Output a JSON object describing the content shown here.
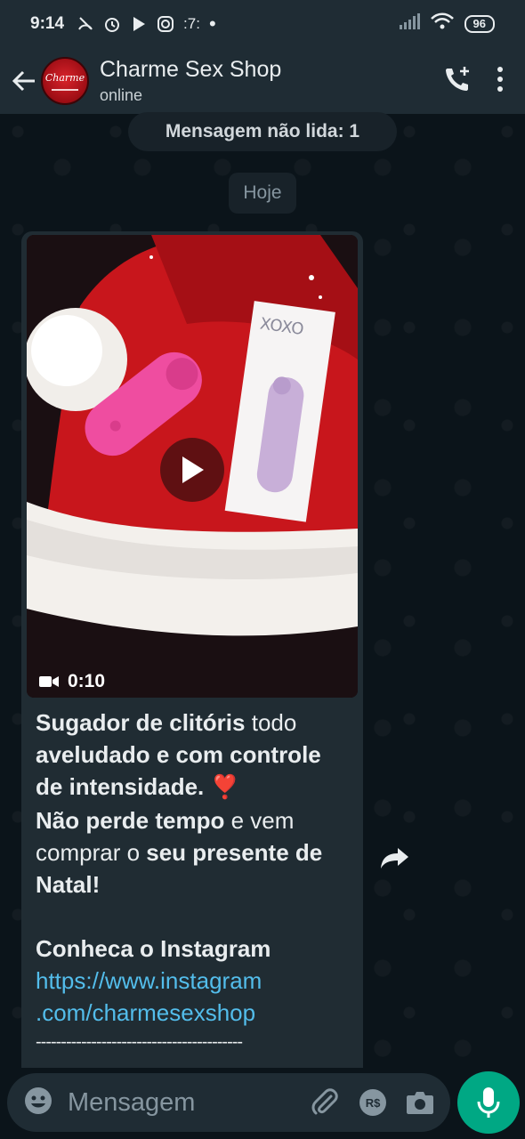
{
  "status_bar": {
    "time": "9:14",
    "notif_extra": ":7:",
    "battery": "96"
  },
  "header": {
    "contact_name": "Charme Sex Shop",
    "status": "online",
    "avatar_logo_text": "Charme"
  },
  "chat": {
    "unread_banner": "Mensagem não lida: 1",
    "date_chip": "Hoje",
    "video": {
      "duration": "0:10",
      "box_brand": "XOXO"
    },
    "message": {
      "p1_bold": "Sugador de clitóris",
      "p1_normal": " todo ",
      "p1_bold2": "aveludado e com controle de intensidade.",
      "p1_emoji": "❣️",
      "p2_bold": "Não perde tempo",
      "p2_normal": " e vem comprar o ",
      "p2_bold2": "seu presente de Natal!",
      "p3_bold": "Conheca o Instagram",
      "link_line1": "https://www.instagram",
      "link_line2": ".com/charmesexshop",
      "separator": "-----------------------------------------"
    }
  },
  "input_bar": {
    "placeholder": "Mensagem",
    "currency_label": "R$"
  },
  "colors": {
    "accent": "#00a884",
    "link": "#53bdeb",
    "bubble": "#202c33",
    "bar": "#1f2c34"
  }
}
